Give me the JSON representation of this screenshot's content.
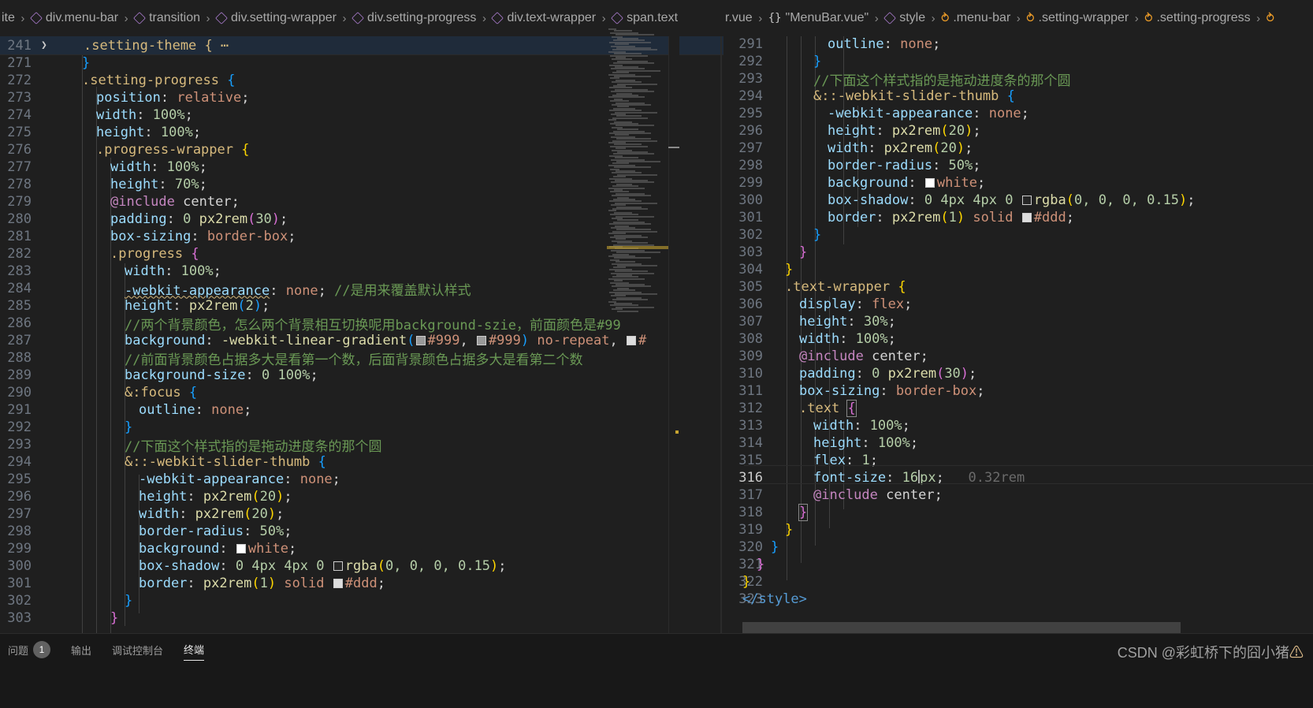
{
  "breadcrumb_left": [
    "ite",
    "div.menu-bar",
    "transition",
    "div.setting-wrapper",
    "div.setting-progress",
    "div.text-wrapper",
    "span.text"
  ],
  "breadcrumb_right": [
    "r.vue",
    "\"MenuBar.vue\"",
    "style",
    ".menu-bar",
    ".setting-wrapper",
    ".setting-progress"
  ],
  "editor_left": {
    "sticky_line_number": "241",
    "sticky_text": ".setting-theme { ⋯",
    "line_numbers": [
      "271",
      "272",
      "273",
      "274",
      "275",
      "276",
      "277",
      "278",
      "279",
      "280",
      "281",
      "282",
      "283",
      "284",
      "285",
      "286",
      "287",
      "288",
      "289",
      "290",
      "291",
      "292",
      "293",
      "294",
      "295",
      "296",
      "297",
      "298",
      "299",
      "300",
      "301",
      "302",
      "303"
    ]
  },
  "editor_right": {
    "line_numbers": [
      "291",
      "292",
      "293",
      "294",
      "295",
      "296",
      "297",
      "298",
      "299",
      "300",
      "301",
      "302",
      "303",
      "304",
      "305",
      "306",
      "307",
      "308",
      "309",
      "310",
      "311",
      "312",
      "313",
      "314",
      "315",
      "316",
      "317",
      "318",
      "319",
      "320",
      "321",
      "322",
      "323"
    ],
    "active_line": "316"
  },
  "code": {
    "kw_position": "position",
    "kw_relative": "relative",
    "kw_width": "width",
    "kw_height": "height",
    "kw_include": "@include",
    "kw_center": "center",
    "kw_padding": "padding",
    "kw_box_sizing": "box-sizing",
    "kw_border_box": "border-box",
    "kw_webkit_appearance": "-webkit-appearance",
    "kw_none": "none",
    "kw_background": "background",
    "kw_background_size": "background-size",
    "kw_outline": "outline",
    "kw_border_radius": "border-radius",
    "kw_box_shadow": "box-shadow",
    "kw_border": "border",
    "kw_display": "display",
    "kw_flex": "flex",
    "kw_font_size": "font-size",
    "kw_white": "white",
    "kw_solid": "solid",
    "kw_no_repeat": "no-repeat",
    "fn_px2rem": "px2rem",
    "fn_linear_gradient": "-webkit-linear-gradient",
    "fn_rgba": "rgba",
    "sel_setting_progress": ".setting-progress",
    "sel_progress_wrapper": ".progress-wrapper",
    "sel_progress": ".progress",
    "sel_focus": "&:focus",
    "sel_thumb": "&::-webkit-slider-thumb",
    "sel_text_wrapper": ".text-wrapper",
    "sel_text": ".text",
    "v_100": "100%",
    "v_70": "70%",
    "v_30p": "30%",
    "v_50": "50%",
    "v_0": "0",
    "v_0_100": "0 100%",
    "v_1": "1",
    "v_2": "2",
    "v_20": "20",
    "v_30": "30",
    "v_4px": "4px",
    "v_16px_a": "16",
    "v_16px_b": "px",
    "v_0_32rem": "0.32rem",
    "v_rgba_args": "0, 0, 0, 0.15",
    "c_999": "#999",
    "c_ddd": "#ddd",
    "c_hash": "#",
    "cmt_284": "//是用来覆盖默认样式",
    "cmt_286": "//两个背景颜色，怎么两个背景相互切换呢用background-szie，前面颜色是#99",
    "cmt_288": "//前面背景颜色占据多大是看第一个数，后面背景颜色占据多大是看第二个数",
    "cmt_293": "//下面这个样式指的是拖动进度条的那个圆",
    "tag_style_close": "</style>"
  },
  "panel": {
    "tabs": [
      "问题",
      "输出",
      "调试控制台",
      "终端"
    ],
    "problems_count": "1",
    "active_tab": "终端",
    "watermark": "CSDN @彩虹桥下的囧小猪",
    "warning_glyph": "⚠"
  },
  "colors": {
    "editor_bg": "#1f1f1f",
    "selector": "#d7ba7d",
    "property": "#9cdcfe",
    "string_value": "#ce9178",
    "number": "#b5cea8",
    "comment": "#6a9955",
    "function": "#dcdcaa",
    "at_rule": "#c586c0",
    "swatch_999": "#999999",
    "swatch_white": "#ffffff",
    "swatch_ddd": "#dddddd",
    "swatch_rgba": "#262626"
  }
}
